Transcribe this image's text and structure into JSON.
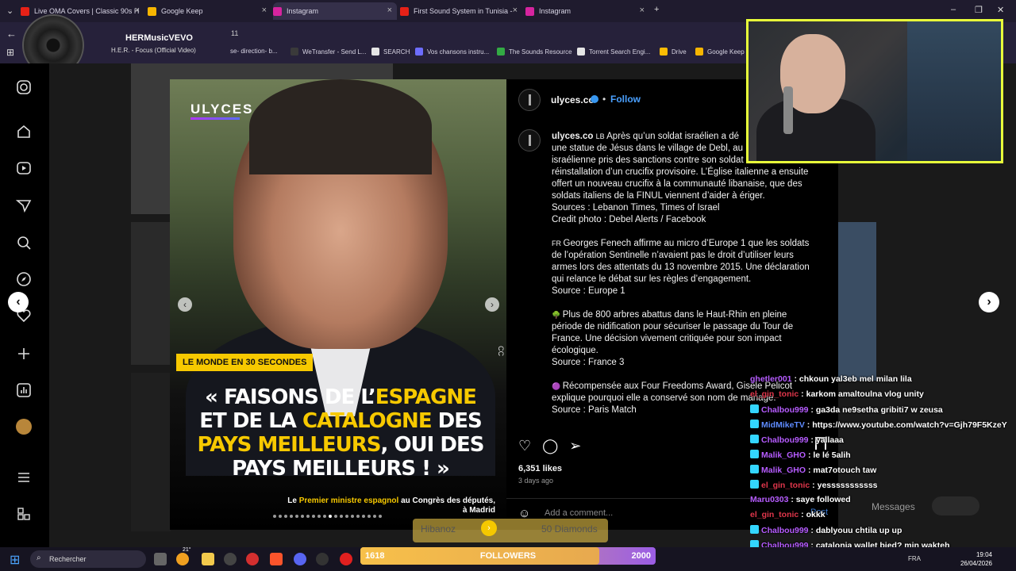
{
  "browser": {
    "tabs": [
      {
        "label": "Live OMA Covers | Classic 90s H",
        "color": "#e62117"
      },
      {
        "label": "Google Keep",
        "color": "#f7b500"
      },
      {
        "label": "Instagram",
        "color": "#d6249f"
      },
      {
        "label": "First Sound System in Tunisia -",
        "color": "#e62117"
      },
      {
        "label": "Instagram",
        "color": "#d6249f"
      }
    ],
    "new_tab": "+",
    "address_suffix": "11",
    "bookmarks": [
      {
        "label": "se- direction- b...",
        "color": "#6b6b6b"
      },
      {
        "label": "WeTransfer - Send L...",
        "color": "#3a3a3a"
      },
      {
        "label": "SEARCH",
        "color": "#e5e5e5"
      },
      {
        "label": "Vos chansons instru...",
        "color": "#6d6dff"
      },
      {
        "label": "The Sounds Resource",
        "color": "#33aa44"
      },
      {
        "label": "Torrent Search Engi...",
        "color": "#e5e5e5"
      },
      {
        "label": "Drive",
        "color": "#fbbc04"
      },
      {
        "label": "Google Keep",
        "color": "#f7b500"
      }
    ]
  },
  "music": {
    "artist": "HERMusicVEVO",
    "song": "H.E.R. - Focus (Official Video)"
  },
  "sidebar_icons": [
    "instagram-icon",
    "home-icon",
    "reels-icon",
    "direct-icon",
    "search-icon",
    "explore-icon",
    "notifications-icon",
    "create-icon",
    "insights-icon",
    "profile-icon",
    "menu-icon",
    "apps-icon"
  ],
  "post": {
    "image": {
      "brand": "ULYCES",
      "badge": "LE MONDE EN 30 SECONDES",
      "headline_parts": [
        {
          "text": "« FAISONS DE L’",
          "highlight": false
        },
        {
          "text": "ESPAGNE",
          "highlight": true
        },
        {
          "text": " ET DE LA ",
          "highlight": false
        },
        {
          "text": "CATALOGNE",
          "highlight": true
        },
        {
          "text": " DES ",
          "highlight": false
        },
        {
          "text": "PAYS MEILLEURS",
          "highlight": true
        },
        {
          "text": ", OUI DES PAYS MEILLEURS ! »",
          "highlight": false
        }
      ],
      "caption_pre": "Le ",
      "caption_highlight": "Premier ministre espagnol",
      "caption_post": " au Congrès des députés,",
      "caption_line2": "à Madrid",
      "cc": "CC",
      "dots_total": 20,
      "dots_active": 10
    },
    "header": {
      "handle": "ulyces.co",
      "follow": "Follow",
      "separator": "•"
    },
    "body": {
      "handle": "ulyces.co",
      "paragraphs": [
        {
          "prefix": "LB",
          "lines": [
            "Après qu’un soldat israélien a dé",
            "une statue de Jésus dans le village de Debl, au l",
            "israélienne pris des sanctions contre son soldat",
            "réinstallation d’un crucifix provisoire. L’Église italienne a ensuite",
            "offert un nouveau crucifix à la communauté libanaise, que des",
            "soldats italiens de la FINUL viennent d’aider à ériger.",
            "Sources : Lebanon Times, Times of Israel",
            "Credit photo : Debel Alerts / Facebook"
          ]
        },
        {
          "prefix": "FR",
          "lines": [
            "Georges Fenech affirme au micro d’Europe 1 que les soldats",
            "de l’opération Sentinelle n’avaient pas le droit d’utiliser leurs",
            "armes lors des attentats du 13 novembre 2015. Une déclaration",
            "qui relance le débat sur les règles d’engagement.",
            "Source : Europe 1"
          ]
        },
        {
          "prefix": "🌳",
          "lines": [
            "Plus de 800 arbres abattus dans le Haut-Rhin en pleine",
            "période de nidification pour sécuriser le passage du Tour de",
            "France. Une décision vivement critiquée pour son impact",
            "écologique.",
            "Source : France 3"
          ]
        },
        {
          "prefix": "🟣",
          "lines": [
            "Récompensée aux Four Freedoms Award, Gisèle Pelicot",
            "explique pourquoi elle a conservé son nom de mariage.",
            "Source : Paris Match"
          ]
        }
      ]
    },
    "likes": "6,351 likes",
    "ago": "3 days ago",
    "comment_placeholder": "Add a comment...",
    "messages": "Messages",
    "post_btn": "Post"
  },
  "chat": [
    {
      "user": "ghetler001",
      "text": "chkoun yal3eb mel milan lila",
      "color": "#b65cff",
      "badge": false
    },
    {
      "user": "el_gin_tonic",
      "text": "karkom amaltoulna vlog unity",
      "color": "#e0364b",
      "badge": false
    },
    {
      "user": "Chalbou999",
      "text": "ga3da ne9setha gribiti7 w zeusa",
      "color": "#b65cff",
      "badge": true
    },
    {
      "user": "MidMikeTV",
      "text": "https://www.youtube.com/watch?v=Gjh79F5KzeY",
      "color": "#5e8bff",
      "badge": true
    },
    {
      "user": "Chalbou999",
      "text": "yallaaa",
      "color": "#b65cff",
      "badge": true
    },
    {
      "user": "Malik_GHO",
      "text": "le lé 5alih",
      "color": "#b65cff",
      "badge": true
    },
    {
      "user": "Malik_GHO",
      "text": "mat7otouch taw",
      "color": "#b65cff",
      "badge": true
    },
    {
      "user": "el_gin_tonic",
      "text": "yesssssssssss",
      "color": "#e0364b",
      "badge": true
    },
    {
      "user": "Maru0303",
      "text": "saye followed",
      "color": "#b65cff",
      "badge": false
    },
    {
      "user": "el_gin_tonic",
      "text": "okkk",
      "color": "#e0364b",
      "badge": false
    },
    {
      "user": "Chalbou999",
      "text": "dablyouu chtila up up",
      "color": "#b65cff",
      "badge": true
    },
    {
      "user": "Chalbou999",
      "text": "catalonia wallet bied? min wakteh",
      "color": "#b65cff",
      "badge": true
    }
  ],
  "goal": {
    "current": "1618",
    "label": "FOLLOWERS",
    "target": "2000",
    "progress": 0.809
  },
  "donation": {
    "name": "Hibanoz",
    "amount": "50 Diamonds"
  },
  "taskbar": {
    "search": "Rechercher",
    "time": "19:04",
    "date": "26/04/2026",
    "lang": "FRA",
    "weather": "21°"
  }
}
